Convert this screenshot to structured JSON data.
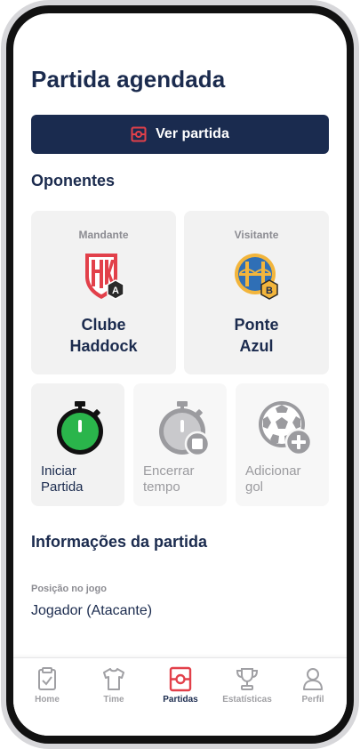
{
  "page": {
    "title": "Partida agendada"
  },
  "primary_button": {
    "label": "Ver partida",
    "icon": "field-icon"
  },
  "opponents": {
    "title": "Oponentes",
    "home": {
      "role": "Mandante",
      "name_line1": "Clube",
      "name_line2": "Haddock",
      "badge": "A",
      "crest": "clube-haddock-crest"
    },
    "away": {
      "role": "Visitante",
      "name_line1": "Ponte",
      "name_line2": "Azul",
      "badge": "B",
      "crest": "ponte-azul-crest"
    }
  },
  "actions": [
    {
      "line1": "Iniciar",
      "line2": "Partida",
      "icon": "stopwatch-play-icon",
      "enabled": true
    },
    {
      "line1": "Encerrar",
      "line2": "tempo",
      "icon": "stopwatch-stop-icon",
      "enabled": false
    },
    {
      "line1": "Adicionar",
      "line2": "gol",
      "icon": "soccer-ball-add-icon",
      "enabled": false
    }
  ],
  "match_info": {
    "title": "Informações da partida",
    "position_label": "Posição no jogo",
    "position_value": "Jogador (Atacante)"
  },
  "tabbar": {
    "active": "Partidas",
    "items": [
      {
        "label": "Home",
        "icon": "clipboard-check-icon"
      },
      {
        "label": "Time",
        "icon": "shirt-icon"
      },
      {
        "label": "Partidas",
        "icon": "field-icon"
      },
      {
        "label": "Estatísticas",
        "icon": "trophy-icon"
      },
      {
        "label": "Perfil",
        "icon": "user-icon"
      }
    ]
  },
  "colors": {
    "navy": "#1a2b4f",
    "accent_red": "#e2404a",
    "go_green": "#2ab54b",
    "disabled_gray": "#9b9b9f",
    "card_bg": "#f2f2f2"
  }
}
